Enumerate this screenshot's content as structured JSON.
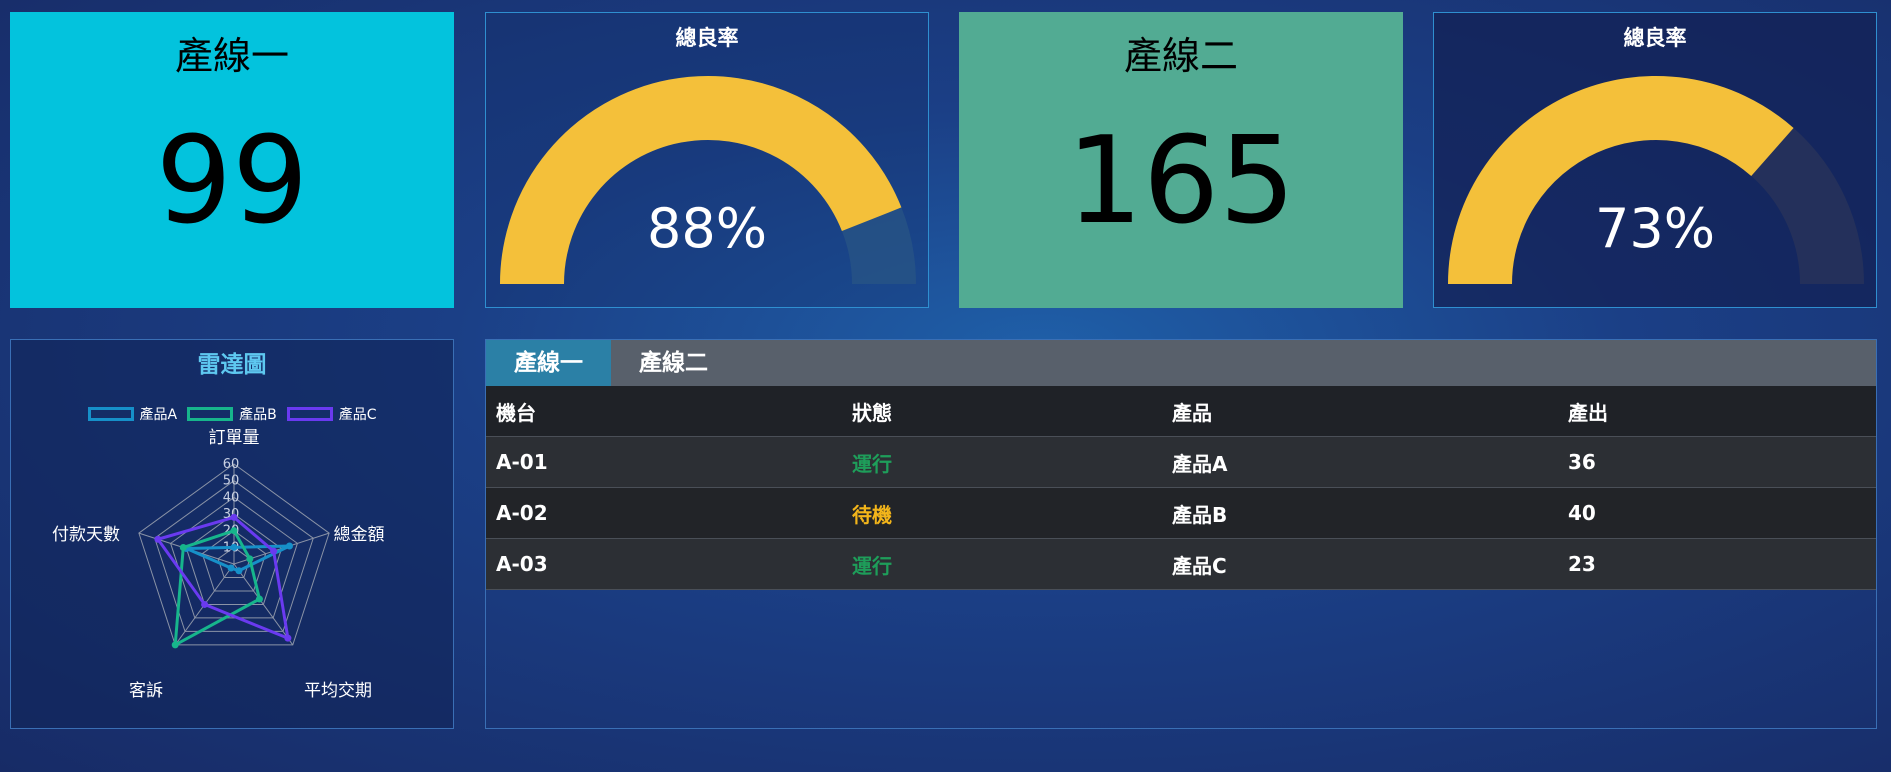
{
  "line1": {
    "title": "產線一",
    "count": "99",
    "color": "#03c3dd"
  },
  "yield1": {
    "title": "總良率",
    "value_text": "88%",
    "percent": 88
  },
  "line2": {
    "title": "產線二",
    "count": "165"
  },
  "yield2": {
    "title": "總良率",
    "value_text": "73%",
    "percent": 73
  },
  "radar": {
    "title": "雷達圖",
    "legend": [
      {
        "label": "產品A",
        "color": "#1690c9"
      },
      {
        "label": "產品B",
        "color": "#17b58c"
      },
      {
        "label": "產品C",
        "color": "#6a3af0"
      }
    ],
    "chart_data": {
      "type": "radar",
      "indicators": [
        "訂單量",
        "總金額",
        "平均交期",
        "客訴",
        "付款天數"
      ],
      "max": 60,
      "ticks": [
        "60",
        "50",
        "40",
        "30",
        "20",
        "10"
      ],
      "series": [
        {
          "name": "產品A",
          "values": [
            10,
            35,
            5,
            3,
            30
          ]
        },
        {
          "name": "產品B",
          "values": [
            20,
            10,
            26,
            60,
            32
          ]
        },
        {
          "name": "產品C",
          "values": [
            28,
            25,
            55,
            30,
            48
          ]
        }
      ]
    }
  },
  "table": {
    "tabs": [
      "產線一",
      "產線二"
    ],
    "active_tab": 0,
    "headers": [
      "機台",
      "狀態",
      "產品",
      "產出"
    ],
    "rows": [
      {
        "machine": "A-01",
        "status": "運行",
        "status_color": "#1e9e5a",
        "product": "產品A",
        "output": "36"
      },
      {
        "machine": "A-02",
        "status": "待機",
        "status_color": "#f3b51a",
        "product": "產品B",
        "output": "40"
      },
      {
        "machine": "A-03",
        "status": "運行",
        "status_color": "#1e9e5a",
        "product": "產品C",
        "output": "23"
      }
    ]
  }
}
